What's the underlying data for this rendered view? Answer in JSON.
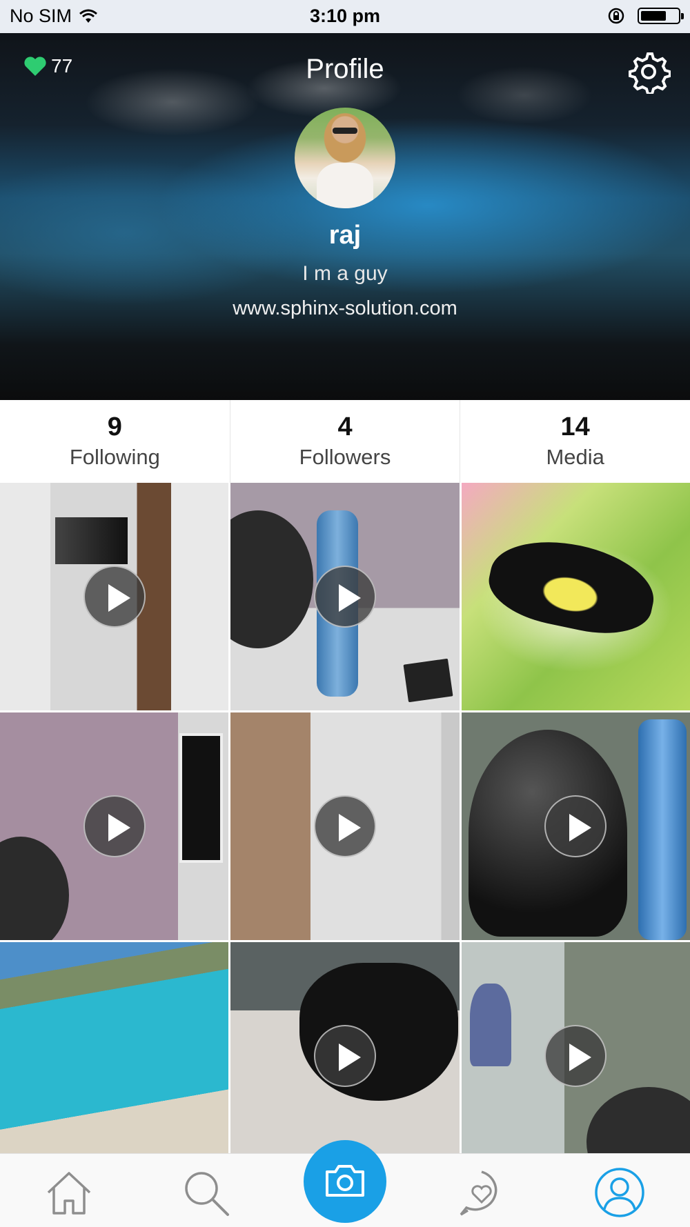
{
  "status_bar": {
    "carrier": "No SIM",
    "time": "3:10 pm"
  },
  "header": {
    "likes_count": "77",
    "title": "Profile"
  },
  "profile": {
    "name": "raj",
    "bio": "I m a guy",
    "website": "www.sphinx-solution.com"
  },
  "stats": [
    {
      "value": "9",
      "label": "Following"
    },
    {
      "value": "4",
      "label": "Followers"
    },
    {
      "value": "14",
      "label": "Media"
    }
  ],
  "media_grid": [
    {
      "type": "video"
    },
    {
      "type": "video"
    },
    {
      "type": "photo"
    },
    {
      "type": "video"
    },
    {
      "type": "video"
    },
    {
      "type": "video"
    },
    {
      "type": "photo"
    },
    {
      "type": "video"
    },
    {
      "type": "video"
    }
  ],
  "tab_bar": {
    "items": [
      "home-icon",
      "search-icon",
      "camera-icon",
      "activity-heart-icon",
      "profile-icon"
    ],
    "accent": "#1aa0e6",
    "active": "profile-icon"
  },
  "colors": {
    "like_heart": "#2ecc71",
    "accent": "#1aa0e6"
  }
}
